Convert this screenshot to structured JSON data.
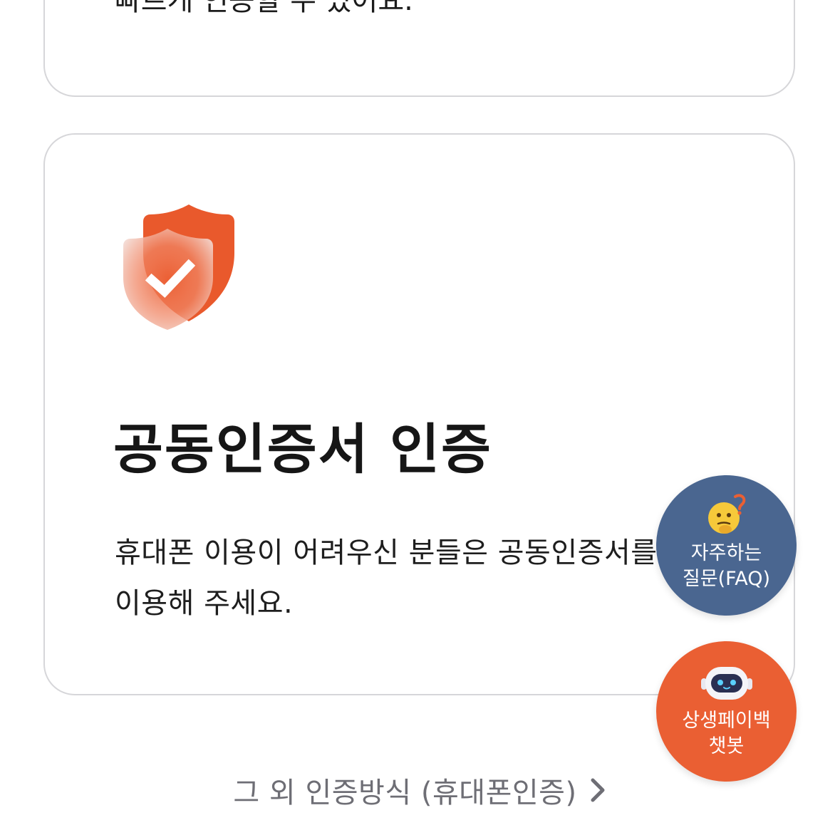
{
  "top_card": {
    "description_tail": "빠르게 인증할 수 있어요."
  },
  "main_card": {
    "icon": "shield-check-icon",
    "title": "공동인증서 인증",
    "description": "휴대폰 이용이 어려우신 분들은 공동인증서를\n이용해 주세요.",
    "accent_color": "#ea5f33"
  },
  "faq_button": {
    "icon": "thinking-face-icon",
    "label": "자주하는\n질문(FAQ)",
    "color": "#4a6690"
  },
  "chatbot_button": {
    "icon": "robot-icon",
    "label": "상생페이백\n챗봇",
    "color": "#ea5f33"
  },
  "other_methods": {
    "label": "그 외 인증방식 (휴대폰인증)",
    "icon": "chevron-right-icon"
  }
}
